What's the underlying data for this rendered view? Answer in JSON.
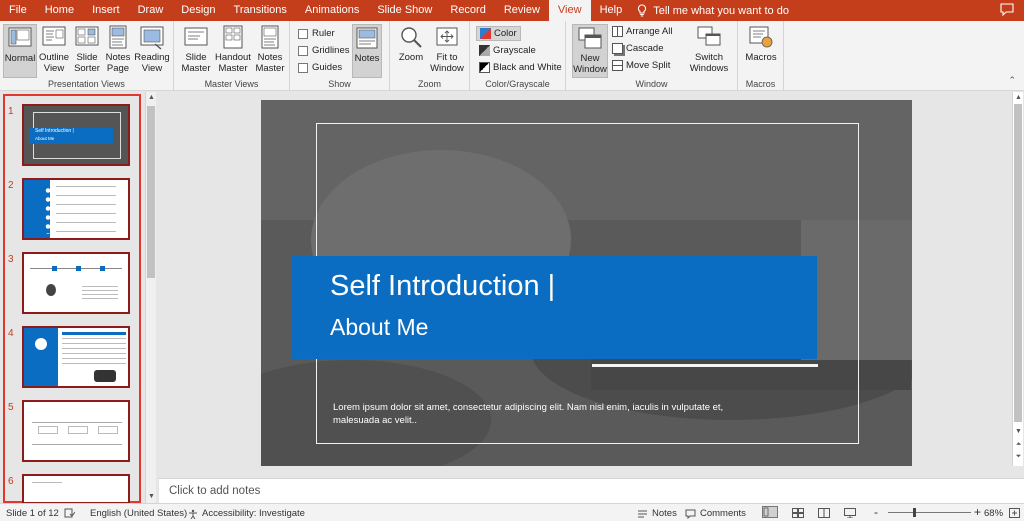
{
  "ribbon_tabs": {
    "file": "File",
    "home": "Home",
    "insert": "Insert",
    "draw": "Draw",
    "design": "Design",
    "transitions": "Transitions",
    "animations": "Animations",
    "slideshow": "Slide Show",
    "record": "Record",
    "review": "Review",
    "view": "View",
    "help": "Help",
    "tell_me": "Tell me what you want to do"
  },
  "groups": {
    "presentation_views": {
      "label": "Presentation Views",
      "normal": "Normal",
      "outline_view": "Outline View",
      "slide_sorter": "Slide Sorter",
      "notes_page": "Notes Page",
      "reading_view": "Reading View"
    },
    "master_views": {
      "label": "Master Views",
      "slide_master": "Slide Master",
      "handout_master": "Handout Master",
      "notes_master": "Notes Master"
    },
    "show": {
      "label": "Show",
      "ruler": "Ruler",
      "gridlines": "Gridlines",
      "guides": "Guides",
      "notes": "Notes"
    },
    "zoom": {
      "label": "Zoom",
      "zoom": "Zoom",
      "fit_to_window": "Fit to Window"
    },
    "color_grayscale": {
      "label": "Color/Grayscale",
      "color": "Color",
      "grayscale": "Grayscale",
      "black_white": "Black and White"
    },
    "window": {
      "label": "Window",
      "new_window": "New Window",
      "arrange_all": "Arrange All",
      "cascade": "Cascade",
      "move_split": "Move Split",
      "switch_windows": "Switch Windows"
    },
    "macros": {
      "label": "Macros",
      "macros": "Macros"
    }
  },
  "thumbnails": {
    "t1": {
      "num": "1",
      "title": "Self Introduction |",
      "sub": "About Me"
    },
    "t2": {
      "num": "2"
    },
    "t3": {
      "num": "3"
    },
    "t4": {
      "num": "4"
    },
    "t5": {
      "num": "5"
    },
    "t6": {
      "num": "6"
    }
  },
  "slide": {
    "title": "Self Introduction |",
    "subtitle": "About Me",
    "body": "Lorem ipsum dolor sit amet, consectetur adipiscing elit. Nam nisl enim, iaculis in vulputate et, malesuada ac velit.."
  },
  "notes_placeholder": "Click to add notes",
  "status": {
    "slide_count": "Slide 1 of 12",
    "language": "English (United States)",
    "accessibility": "Accessibility: Investigate",
    "notes": "Notes",
    "comments": "Comments",
    "zoom": "68%",
    "zoom_minus": "-",
    "zoom_plus": "+"
  },
  "colors": {
    "ribbon_accent": "#c43e1c",
    "title_box": "#0a6dc2",
    "thumb_selection": "#e0382e"
  }
}
